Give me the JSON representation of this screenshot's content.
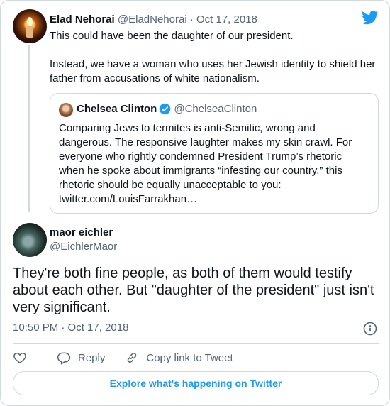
{
  "parent": {
    "name": "Elad Nehorai",
    "handle": "@EladNehorai",
    "separator": " · ",
    "date": "Oct 17, 2018",
    "text_1": "This could have been the daughter of our president.",
    "text_2": "Instead, we have a woman who uses her Jewish identity to shield her father from accusations of white nationalism."
  },
  "quote": {
    "name": "Chelsea Clinton",
    "handle": "@ChelseaClinton",
    "verified_icon": "verified-badge-icon",
    "text": "Comparing Jews to termites is anti-Semitic, wrong and dangerous. The responsive laughter makes my skin crawl. For everyone who rightly condemned President Trump’s rhetoric when he spoke about immigrants “infesting our country,” this rhetoric should be equally unacceptable to you: twitter.com/LouisFarrakhan…"
  },
  "reply": {
    "name": "maor eichler",
    "handle": "@EichlerMaor",
    "text": "They're both fine people, as both of them would testify about each other. But \"daughter of the president\" just isn't very significant.",
    "timestamp": "10:50 PM · Oct 17, 2018"
  },
  "actions": {
    "reply_label": "Reply",
    "copy_link_label": "Copy link to Tweet"
  },
  "footer": {
    "explore_label": "Explore what's happening on Twitter"
  },
  "colors": {
    "accent": "#1d9bf0",
    "muted": "#536471",
    "border": "#cfd9de"
  }
}
